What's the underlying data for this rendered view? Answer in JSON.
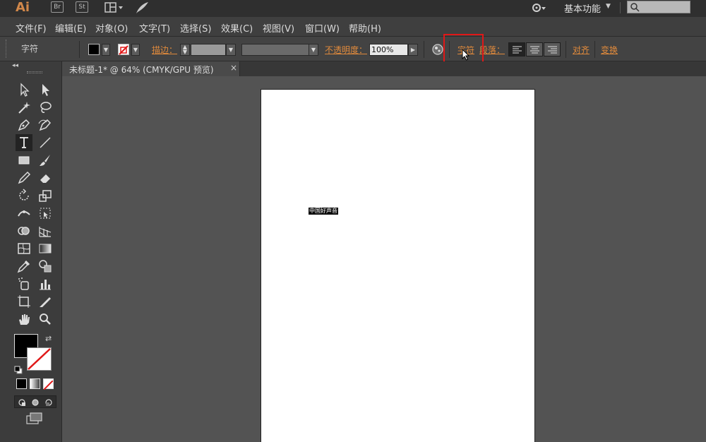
{
  "app": {
    "logo": "Ai",
    "bridge_label": "Br",
    "stock_label": "St",
    "workspace_label": "基本功能"
  },
  "menu": {
    "items": [
      "文件(F)",
      "编辑(E)",
      "对象(O)",
      "文字(T)",
      "选择(S)",
      "效果(C)",
      "视图(V)",
      "窗口(W)",
      "帮助(H)"
    ]
  },
  "control_bar": {
    "label": "字符",
    "stroke_label": "描边：",
    "opacity_label": "不透明度：",
    "opacity_value": "100%",
    "character_link": "字符",
    "paragraph_link": "段落：",
    "align_link": "对齐",
    "transform_link": "变换",
    "fill_color": "#000000",
    "highlight_color": "#e01818",
    "link_color": "#e08a3c"
  },
  "document": {
    "tab_label": "未标题-1* @ 64% (CMYK/GPU 预览)",
    "close_label": "×"
  },
  "artboard": {
    "text_content": "中国好声音"
  },
  "icons": {
    "workspace_menu": "chevron-down-icon",
    "search": "search-icon",
    "recolor": "globe-icon"
  }
}
